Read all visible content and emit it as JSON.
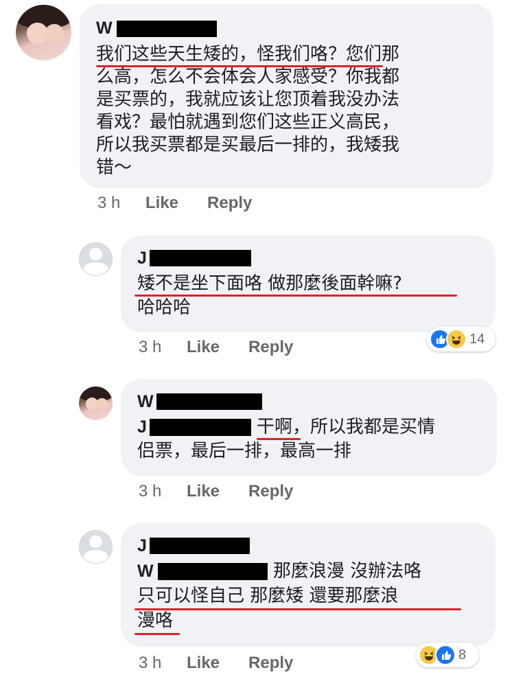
{
  "comments": [
    {
      "author_initial": "W",
      "lines": [
        "我们这些天生矮的，怪我们咯？您们那",
        "么高，怎么不会体会人家感受？你我都",
        "是买票的，我就应该让您顶着我没办法",
        "看戏？最怕就遇到您们这些正义高民，",
        "所以我买票都是买最后一排的，我矮我",
        "错～"
      ],
      "time": "3 h",
      "like_label": "Like",
      "reply_label": "Reply"
    },
    {
      "author_initial": "J",
      "lines": [
        "矮不是坐下面咯 做那麼後面幹嘛?",
        "哈哈哈"
      ],
      "time": "3 h",
      "like_label": "Like",
      "reply_label": "Reply",
      "reaction_count": "14"
    },
    {
      "author_initial": "W",
      "mention_initial": "J",
      "line1_rest": "干啊，所以我都是买情",
      "line2": "侣票，最后一排，最高一排",
      "time": "3 h",
      "like_label": "Like",
      "reply_label": "Reply"
    },
    {
      "author_initial": "J",
      "mention_initial": "W",
      "line1_rest": "那麼浪漫 沒辦法咯",
      "line2": "只可以怪自己 那麼矮 還要那麼浪",
      "line3": "漫咯",
      "time": "3 h",
      "like_label": "Like",
      "reply_label": "Reply",
      "reaction_count": "8"
    }
  ],
  "colors": {
    "bubble": "#f0f2f5",
    "underline": "#e0202b",
    "meta_text": "#65676b",
    "like_blue": "#1877f2",
    "haha_yellow": "#f7c94b"
  },
  "icons": [
    "avatar-photo",
    "default-avatar-icon",
    "like-reaction-icon",
    "haha-reaction-icon"
  ]
}
